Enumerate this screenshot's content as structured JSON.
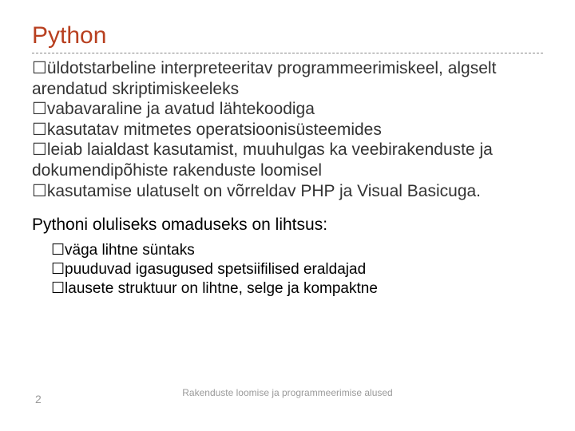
{
  "title": "Python",
  "bullets": [
    "üldotstarbeline interpreteeritav programmeerimiskeel, algselt arendatud skriptimiskeeleks",
    "vabavaraline ja avatud lähtekoodiga",
    "kasutatav mitmetes operatsioonisüsteemides",
    "leiab laialdast kasutamist, muuhulgas ka veebirakenduste ja dokumendipõhiste rakenduste loomisel",
    "kasutamise ulatuselt on võrreldav PHP ja Visual Basicuga."
  ],
  "subheading": "Pythoni oluliseks omaduseks on lihtsus:",
  "sub_bullets": [
    "väga lihtne süntaks",
    "puuduvad igasugused spetsiifilised eraldajad",
    "lausete struktuur on lihtne,  selge ja kompaktne"
  ],
  "bullet_symbol": "☐",
  "page_number": "2",
  "footer": "Rakenduste loomise ja programmeerimise alused"
}
